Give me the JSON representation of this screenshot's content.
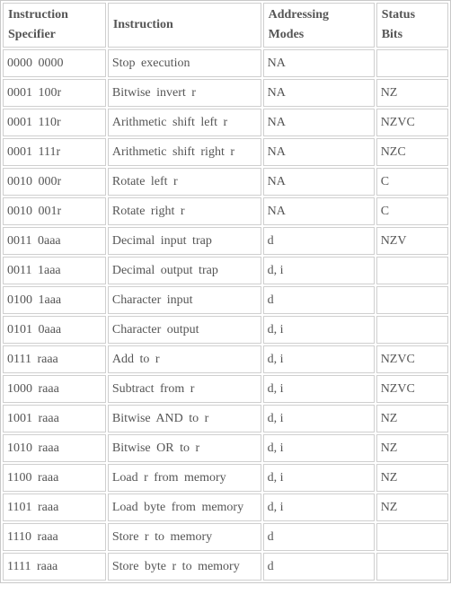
{
  "table": {
    "headers": {
      "specifier": "Instruction Specifier",
      "specifier_line1": "Instruction",
      "specifier_line2": "Specifier",
      "instruction": "Instruction",
      "addressing": "Addressing Modes",
      "addressing_line1": "Addressing",
      "addressing_line2": "Modes",
      "status": "Status Bits",
      "status_line1": "Status",
      "status_line2": "Bits"
    },
    "rows": [
      {
        "specifier": "0000 0000",
        "instruction": "Stop  execution",
        "modes": "NA",
        "status": ""
      },
      {
        "specifier": "0001 100r",
        "instruction": "Bitwise invert r",
        "modes": "NA",
        "status": "NZ"
      },
      {
        "specifier": "0001 110r",
        "instruction": "Arithmetic shift left r",
        "modes": "NA",
        "status": "NZVC"
      },
      {
        "specifier": "0001 111r",
        "instruction": "Arithmetic shift right r",
        "modes": "NA",
        "status": "NZC"
      },
      {
        "specifier": "0010 000r",
        "instruction": "Rotate left r",
        "modes": "NA",
        "status": "C"
      },
      {
        "specifier": "0010 001r",
        "instruction": "Rotate right r",
        "modes": "NA",
        "status": "C"
      },
      {
        "specifier": "0011 0aaa",
        "instruction": "Decimal input trap",
        "modes": "d",
        "status": "NZV"
      },
      {
        "specifier": "0011 1aaa",
        "instruction": "Decimal output trap",
        "modes": "d, i",
        "status": ""
      },
      {
        "specifier": "0100 1aaa",
        "instruction": "Character  input",
        "modes": "d",
        "status": ""
      },
      {
        "specifier": "0101 0aaa",
        "instruction": "Character  output",
        "modes": "d, i",
        "status": ""
      },
      {
        "specifier": "0111 raaa",
        "instruction": "Add to r",
        "modes": "d, i",
        "status": "NZVC"
      },
      {
        "specifier": "1000 raaa",
        "instruction": "Subtract from r",
        "modes": "d, i",
        "status": "NZVC"
      },
      {
        "specifier": "1001 raaa",
        "instruction": "Bitwise AND to r",
        "modes": "d, i",
        "status": "NZ"
      },
      {
        "specifier": "1010 raaa",
        "instruction": "Bitwise OR to r",
        "modes": "d, i",
        "status": "NZ"
      },
      {
        "specifier": "1100 raaa",
        "instruction": "Load r from memory",
        "modes": "d, i",
        "status": "NZ"
      },
      {
        "specifier": "1101 raaa",
        "instruction": "Load byte from memory",
        "modes": "d, i",
        "status": "NZ"
      },
      {
        "specifier": "1110 raaa",
        "instruction": "Store r to memory",
        "modes": "d",
        "status": ""
      },
      {
        "specifier": "1111 raaa",
        "instruction": "Store byte r to memory",
        "modes": "d",
        "status": ""
      }
    ]
  }
}
